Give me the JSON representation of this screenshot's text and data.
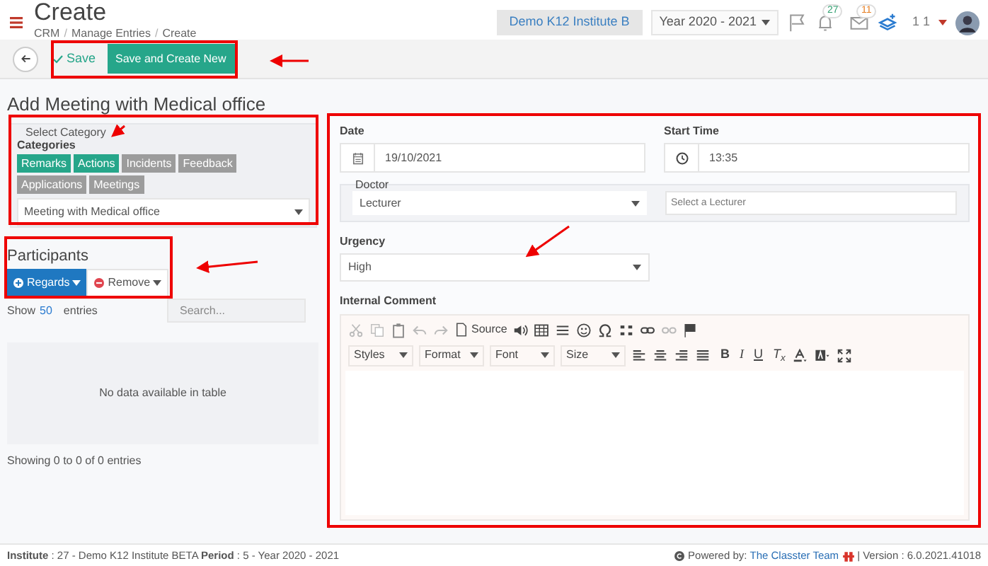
{
  "header": {
    "title": "Create",
    "breadcrumb": [
      {
        "text": "CRM",
        "kind": "link"
      },
      {
        "text": "/",
        "kind": "separator"
      },
      {
        "text": "Manage Entries",
        "kind": "link"
      },
      {
        "text": "/",
        "kind": "separator"
      },
      {
        "text": "Create",
        "kind": "link"
      }
    ],
    "institute_button": "Demo K12 Institute B",
    "year_select": "Year 2020 - 2021",
    "notifications_badge": "27",
    "messages_badge": "11",
    "user_label": "1 1"
  },
  "toolbar": {
    "save": "Save",
    "save_and_new": "Save and Create New"
  },
  "form_title": "Add Meeting with Medical office",
  "category": {
    "legend": "Select Category",
    "label": "Categories",
    "select_value": "Meeting with Medical office",
    "tags": [
      {
        "label": "Remarks",
        "selected": true
      },
      {
        "label": "Actions",
        "selected": true
      },
      {
        "label": "Incidents",
        "selected": false
      },
      {
        "label": "Feedback",
        "selected": false
      },
      {
        "label": "Applications",
        "selected": false
      },
      {
        "label": "Meetings",
        "selected": false
      }
    ]
  },
  "participants": {
    "title": "Participants",
    "add_button": "Regards",
    "remove_button": "Remove",
    "show_label": "Show",
    "page_size": "50",
    "entries_label": "entries",
    "search_placeholder": "Search...",
    "empty_message": "No data available in table",
    "info": "Showing 0 to 0 of 0 entries"
  },
  "details": {
    "date_label": "Date",
    "date_value": "19/10/2021",
    "start_time_label": "Start Time",
    "start_time_value": "13:35",
    "doctor_legend": "Doctor",
    "doctor_type": "Lecturer",
    "lecturer_placeholder": "Select a Lecturer",
    "urgency_label": "Urgency",
    "urgency_value": "High",
    "comment_label": "Internal Comment",
    "editor": {
      "source_button": "Source",
      "dropdowns": [
        "Styles",
        "Format",
        "Font",
        "Size"
      ],
      "format_buttons": [
        {
          "label": "B",
          "kind": "bold"
        },
        {
          "label": "I",
          "kind": "italic"
        },
        {
          "label": "U",
          "kind": "underline"
        },
        {
          "label": "T$_{x}$",
          "kind": "clear"
        }
      ]
    }
  },
  "footer": {
    "status": "**Institute** : 27 - Demo K12 Institute BETA **Period** : 5 - Year 2020 - 2021",
    "powered_by": "Powered by:",
    "team_link": "The Classter Team",
    "version": "| Version : 6.0.2021.41018"
  }
}
